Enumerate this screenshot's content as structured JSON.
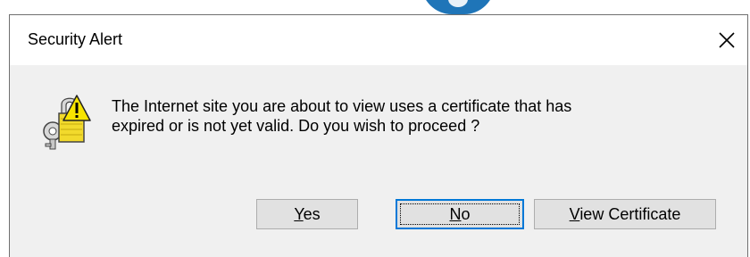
{
  "window": {
    "title": "Security Alert",
    "close_icon": "close-icon"
  },
  "icon": {
    "name": "warning-lock-icon"
  },
  "message": {
    "line1": "The Internet site you are about to view uses a certificate that has",
    "line2": "expired or is not yet valid. Do you wish to proceed ?"
  },
  "buttons": {
    "yes": {
      "mnemonic": "Y",
      "rest": "es"
    },
    "no": {
      "mnemonic": "N",
      "rest": "o"
    },
    "view_certificate": {
      "mnemonic": "V",
      "rest": "iew Certificate"
    }
  },
  "colors": {
    "focus_border": "#0078d7",
    "dialog_bg": "#f0f0f0",
    "button_bg": "#e1e1e1",
    "icon_yellow": "#f2da2c"
  }
}
